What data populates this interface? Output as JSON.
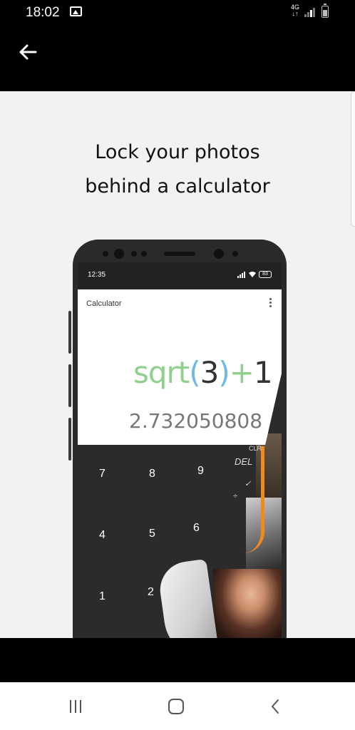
{
  "status_bar": {
    "time": "18:02",
    "network": "4G",
    "icons": [
      "gallery-icon",
      "signal-icon",
      "battery-icon"
    ]
  },
  "app_bar": {
    "back_icon": "arrow-left-icon"
  },
  "content": {
    "headline_line1": "Lock your photos",
    "headline_line2": "behind a calculator",
    "phone": {
      "inner_time": "12:35",
      "inner_battery": "83",
      "app_title": "Calculator",
      "expression_fn": "sqrt",
      "expression_open": "(",
      "expression_num": "3",
      "expression_close": ")",
      "expression_plus": "+",
      "expression_one": "1",
      "result": "2.732050808",
      "keys": {
        "k7": "7",
        "k8": "8",
        "k9": "9",
        "k4": "4",
        "k5": "5",
        "k6": "6",
        "k1": "1",
        "k2": "2",
        "clr": "CLR",
        "del": "DEL",
        "divide": "÷",
        "check": "✓"
      }
    }
  },
  "nav_bar": {
    "icons": [
      "recent-apps-icon",
      "home-icon",
      "back-icon"
    ]
  },
  "colors": {
    "expression_green": "#8fd18c",
    "paren_blue": "#6fb8e6",
    "accent_orange": "#f08a1c",
    "content_bg": "#f2f2f2"
  }
}
